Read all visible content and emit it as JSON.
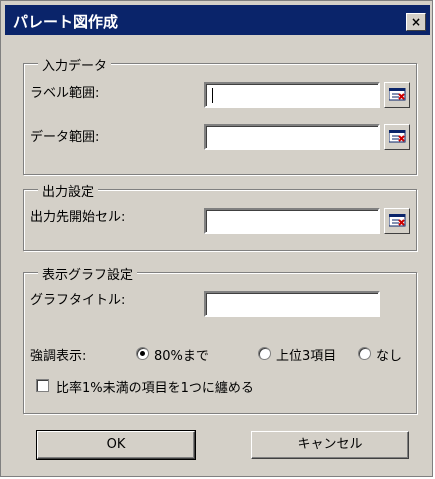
{
  "window": {
    "title": "パレート図作成",
    "close_label": "×"
  },
  "input_group": {
    "legend": "入力データ",
    "label_range_label": "ラベル範囲:",
    "label_range_value": "",
    "data_range_label": "データ範囲:",
    "data_range_value": ""
  },
  "output_group": {
    "legend": "出力設定",
    "dest_cell_label": "出力先開始セル:",
    "dest_cell_value": ""
  },
  "graph_group": {
    "legend": "表示グラフ設定",
    "graph_title_label": "グラフタイトル:",
    "graph_title_value": "",
    "emphasis_label": "強調表示:",
    "options": [
      {
        "label": "80%まで",
        "selected": true
      },
      {
        "label": "上位3項目",
        "selected": false
      },
      {
        "label": "なし",
        "selected": false
      }
    ],
    "combine_checkbox_label": "比率1%未満の項目を1つに纏める",
    "combine_checked": false
  },
  "buttons": {
    "ok": "OK",
    "cancel": "キャンセル"
  },
  "icons": {
    "range_select": "range-select-icon",
    "accent_red": "#cc0000",
    "accent_navy": "#0a246a"
  }
}
